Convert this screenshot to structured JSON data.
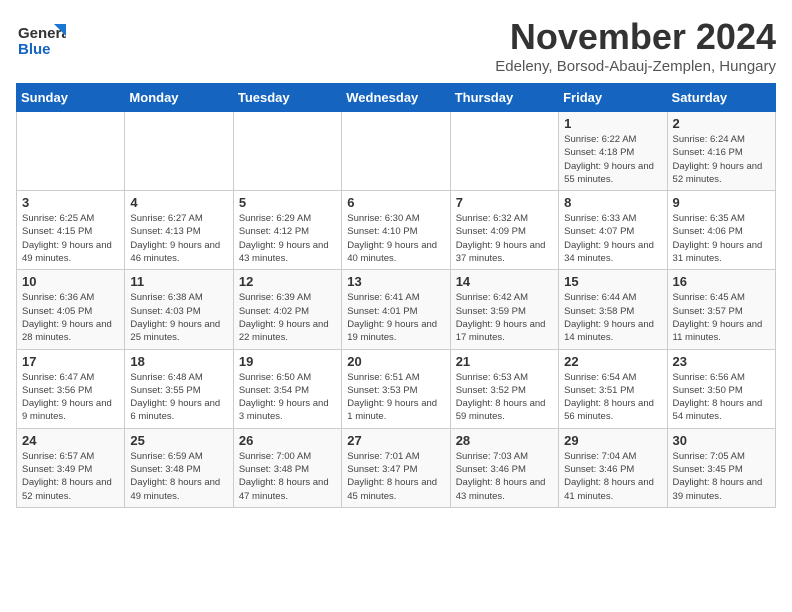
{
  "logo": {
    "line1": "General",
    "line2": "Blue"
  },
  "title": "November 2024",
  "subtitle": "Edeleny, Borsod-Abauj-Zemplen, Hungary",
  "days_of_week": [
    "Sunday",
    "Monday",
    "Tuesday",
    "Wednesday",
    "Thursday",
    "Friday",
    "Saturday"
  ],
  "weeks": [
    [
      {
        "day": "",
        "info": ""
      },
      {
        "day": "",
        "info": ""
      },
      {
        "day": "",
        "info": ""
      },
      {
        "day": "",
        "info": ""
      },
      {
        "day": "",
        "info": ""
      },
      {
        "day": "1",
        "info": "Sunrise: 6:22 AM\nSunset: 4:18 PM\nDaylight: 9 hours and 55 minutes."
      },
      {
        "day": "2",
        "info": "Sunrise: 6:24 AM\nSunset: 4:16 PM\nDaylight: 9 hours and 52 minutes."
      }
    ],
    [
      {
        "day": "3",
        "info": "Sunrise: 6:25 AM\nSunset: 4:15 PM\nDaylight: 9 hours and 49 minutes."
      },
      {
        "day": "4",
        "info": "Sunrise: 6:27 AM\nSunset: 4:13 PM\nDaylight: 9 hours and 46 minutes."
      },
      {
        "day": "5",
        "info": "Sunrise: 6:29 AM\nSunset: 4:12 PM\nDaylight: 9 hours and 43 minutes."
      },
      {
        "day": "6",
        "info": "Sunrise: 6:30 AM\nSunset: 4:10 PM\nDaylight: 9 hours and 40 minutes."
      },
      {
        "day": "7",
        "info": "Sunrise: 6:32 AM\nSunset: 4:09 PM\nDaylight: 9 hours and 37 minutes."
      },
      {
        "day": "8",
        "info": "Sunrise: 6:33 AM\nSunset: 4:07 PM\nDaylight: 9 hours and 34 minutes."
      },
      {
        "day": "9",
        "info": "Sunrise: 6:35 AM\nSunset: 4:06 PM\nDaylight: 9 hours and 31 minutes."
      }
    ],
    [
      {
        "day": "10",
        "info": "Sunrise: 6:36 AM\nSunset: 4:05 PM\nDaylight: 9 hours and 28 minutes."
      },
      {
        "day": "11",
        "info": "Sunrise: 6:38 AM\nSunset: 4:03 PM\nDaylight: 9 hours and 25 minutes."
      },
      {
        "day": "12",
        "info": "Sunrise: 6:39 AM\nSunset: 4:02 PM\nDaylight: 9 hours and 22 minutes."
      },
      {
        "day": "13",
        "info": "Sunrise: 6:41 AM\nSunset: 4:01 PM\nDaylight: 9 hours and 19 minutes."
      },
      {
        "day": "14",
        "info": "Sunrise: 6:42 AM\nSunset: 3:59 PM\nDaylight: 9 hours and 17 minutes."
      },
      {
        "day": "15",
        "info": "Sunrise: 6:44 AM\nSunset: 3:58 PM\nDaylight: 9 hours and 14 minutes."
      },
      {
        "day": "16",
        "info": "Sunrise: 6:45 AM\nSunset: 3:57 PM\nDaylight: 9 hours and 11 minutes."
      }
    ],
    [
      {
        "day": "17",
        "info": "Sunrise: 6:47 AM\nSunset: 3:56 PM\nDaylight: 9 hours and 9 minutes."
      },
      {
        "day": "18",
        "info": "Sunrise: 6:48 AM\nSunset: 3:55 PM\nDaylight: 9 hours and 6 minutes."
      },
      {
        "day": "19",
        "info": "Sunrise: 6:50 AM\nSunset: 3:54 PM\nDaylight: 9 hours and 3 minutes."
      },
      {
        "day": "20",
        "info": "Sunrise: 6:51 AM\nSunset: 3:53 PM\nDaylight: 9 hours and 1 minute."
      },
      {
        "day": "21",
        "info": "Sunrise: 6:53 AM\nSunset: 3:52 PM\nDaylight: 8 hours and 59 minutes."
      },
      {
        "day": "22",
        "info": "Sunrise: 6:54 AM\nSunset: 3:51 PM\nDaylight: 8 hours and 56 minutes."
      },
      {
        "day": "23",
        "info": "Sunrise: 6:56 AM\nSunset: 3:50 PM\nDaylight: 8 hours and 54 minutes."
      }
    ],
    [
      {
        "day": "24",
        "info": "Sunrise: 6:57 AM\nSunset: 3:49 PM\nDaylight: 8 hours and 52 minutes."
      },
      {
        "day": "25",
        "info": "Sunrise: 6:59 AM\nSunset: 3:48 PM\nDaylight: 8 hours and 49 minutes."
      },
      {
        "day": "26",
        "info": "Sunrise: 7:00 AM\nSunset: 3:48 PM\nDaylight: 8 hours and 47 minutes."
      },
      {
        "day": "27",
        "info": "Sunrise: 7:01 AM\nSunset: 3:47 PM\nDaylight: 8 hours and 45 minutes."
      },
      {
        "day": "28",
        "info": "Sunrise: 7:03 AM\nSunset: 3:46 PM\nDaylight: 8 hours and 43 minutes."
      },
      {
        "day": "29",
        "info": "Sunrise: 7:04 AM\nSunset: 3:46 PM\nDaylight: 8 hours and 41 minutes."
      },
      {
        "day": "30",
        "info": "Sunrise: 7:05 AM\nSunset: 3:45 PM\nDaylight: 8 hours and 39 minutes."
      }
    ]
  ]
}
